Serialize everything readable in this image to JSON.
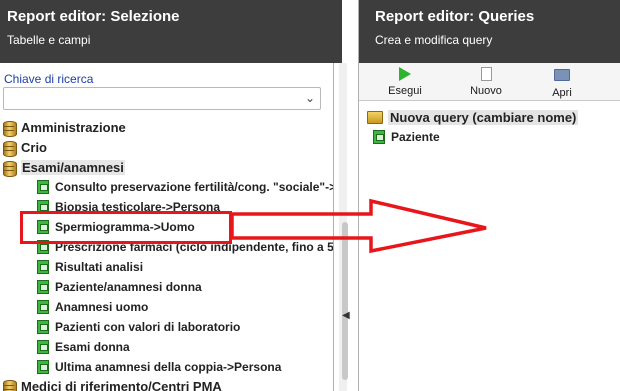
{
  "left_panel": {
    "title": "Report editor: Selezione",
    "subtitle": "Tabelle e campi",
    "search": {
      "label": "Chiave di ricerca",
      "value": ""
    },
    "tree": [
      {
        "label": "Amministrazione",
        "level": 0,
        "icon": "database-icon"
      },
      {
        "label": "Crio",
        "level": 0,
        "icon": "database-icon"
      },
      {
        "label": "Esami/anamnesi",
        "level": 0,
        "icon": "database-icon",
        "selected": true
      },
      {
        "label": "Consulto preservazione fertilità/cong. \"sociale\"->",
        "level": 1,
        "icon": "table-icon"
      },
      {
        "label": "Biopsia testicolare->Persona",
        "level": 1,
        "icon": "table-icon"
      },
      {
        "label": "Spermiogramma->Uomo",
        "level": 1,
        "icon": "table-icon"
      },
      {
        "label": "Prescrizione farmaci (ciclo indipendente, fino a 5",
        "level": 1,
        "icon": "table-icon"
      },
      {
        "label": "Risultati analisi",
        "level": 1,
        "icon": "table-icon"
      },
      {
        "label": "Paziente/anamnesi donna",
        "level": 1,
        "icon": "table-icon"
      },
      {
        "label": "Anamnesi uomo",
        "level": 1,
        "icon": "table-icon"
      },
      {
        "label": "Pazienti con valori di laboratorio",
        "level": 1,
        "icon": "table-icon"
      },
      {
        "label": "Esami donna",
        "level": 1,
        "icon": "table-icon"
      },
      {
        "label": "Ultima anamnesi della coppia->Persona",
        "level": 1,
        "icon": "table-icon"
      },
      {
        "label": "Medici di riferimento/Centri PMA",
        "level": 0,
        "icon": "database-icon"
      }
    ]
  },
  "right_panel": {
    "title": "Report editor: Queries",
    "subtitle": "Crea e modifica query",
    "toolbar": [
      {
        "label": "Esegui",
        "icon": "play-icon"
      },
      {
        "label": "Nuovo",
        "icon": "new-document-icon"
      },
      {
        "label": "Apri",
        "icon": "open-folder-icon"
      }
    ],
    "query_tree": {
      "root": {
        "label": "Nuova query (cambiare nome)",
        "icon": "folder-icon"
      },
      "children": [
        {
          "label": "Paziente",
          "icon": "table-icon"
        }
      ]
    }
  },
  "annotation": {
    "color": "#e8161b"
  }
}
